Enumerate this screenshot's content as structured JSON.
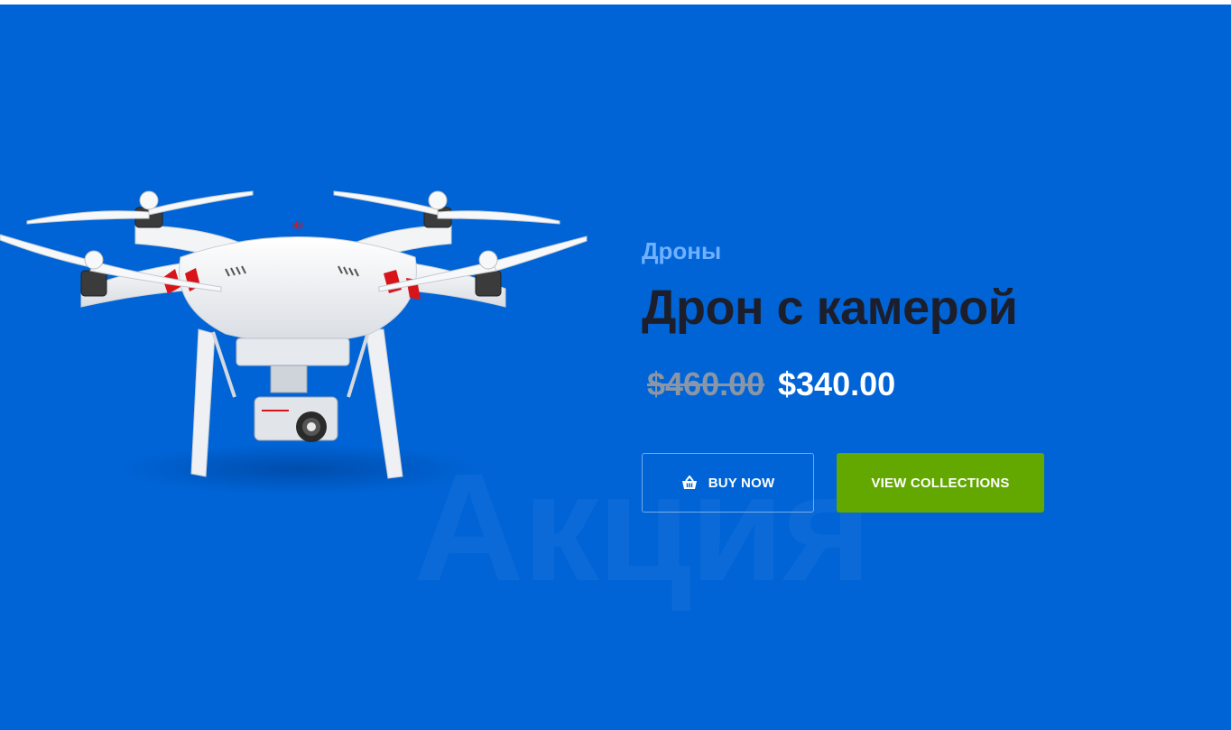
{
  "slide": {
    "watermark": "Акция",
    "category": "Дроны",
    "title": "Дрон с камерой",
    "price_old": "$460.00",
    "price_new": "$340.00",
    "buy_label": "BUY NOW",
    "collections_label": "VIEW COLLECTIONS",
    "drone_brand": "dji"
  },
  "colors": {
    "background": "#0064d6",
    "category": "#6fb0ff",
    "title": "#1c1f2b",
    "old_price": "#8a96a6",
    "accent_green": "#62a800"
  },
  "icons": {
    "buy": "basket-icon"
  }
}
